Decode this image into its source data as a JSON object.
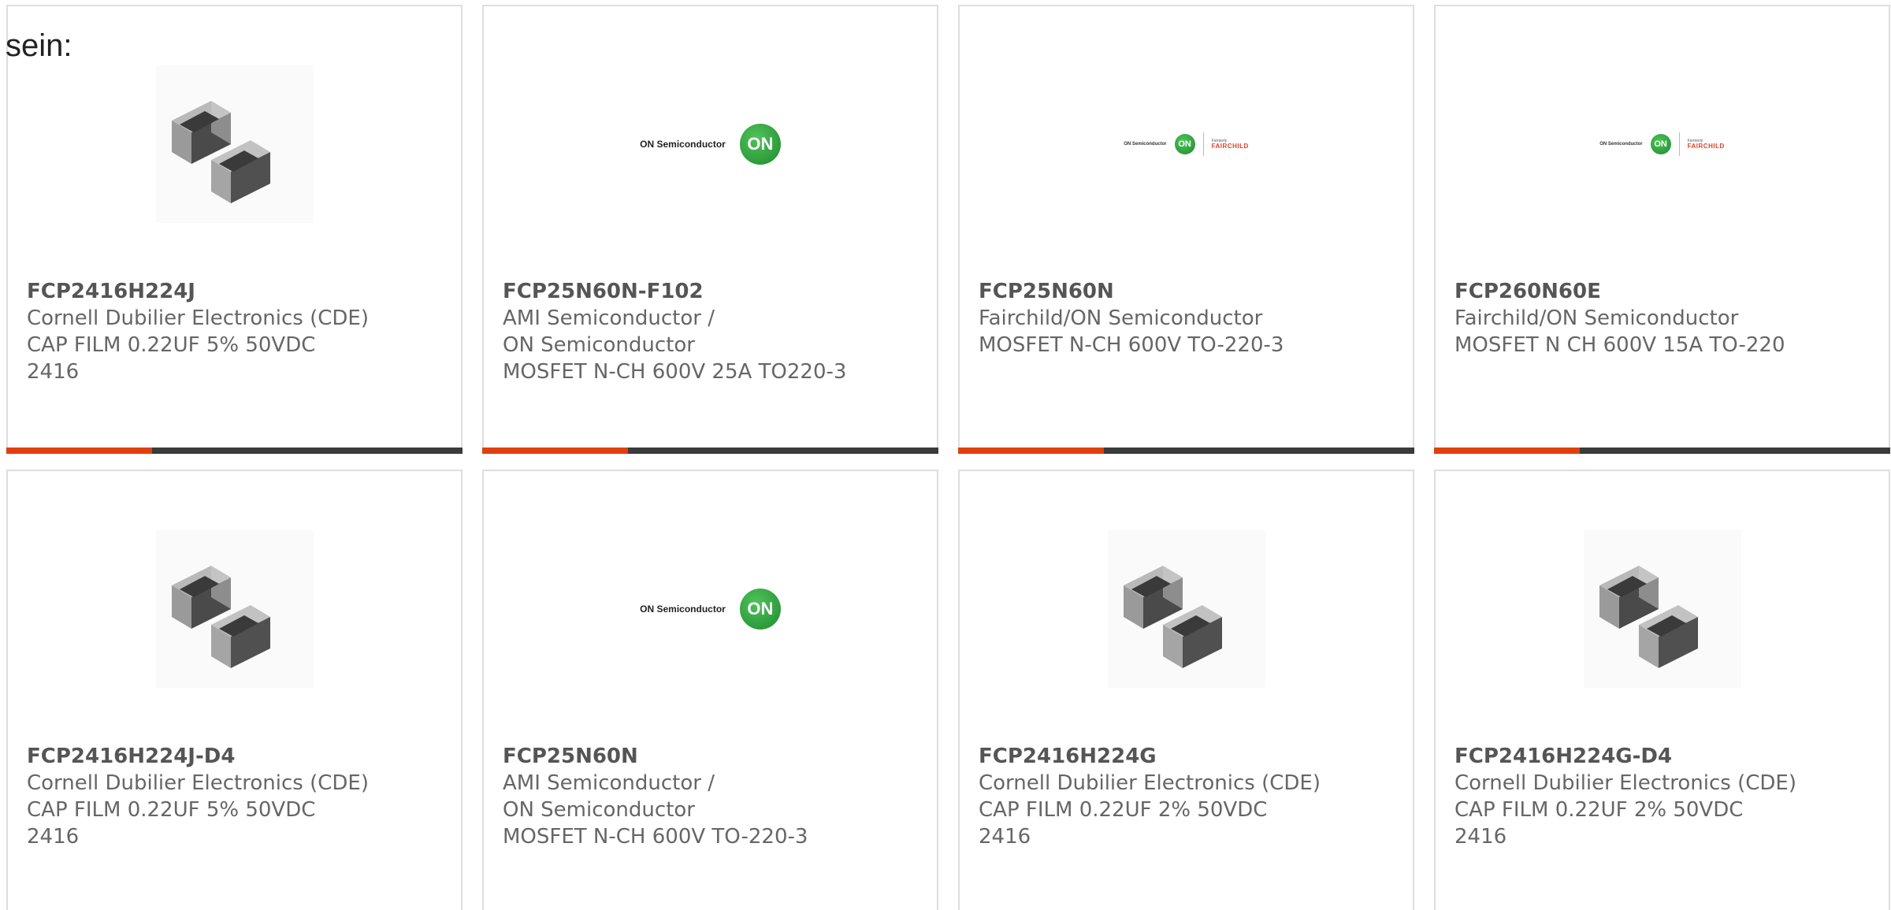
{
  "intro_text": "sein:",
  "colors": {
    "accent": "#e0400f",
    "bar_dark": "#3b3b3b",
    "border": "#dedede",
    "text": "#666666"
  },
  "products": [
    {
      "part_number": "FCP2416H224J",
      "manufacturer": "Cornell Dubilier Electronics (CDE)",
      "description_lines": [
        "CAP FILM 0.22UF 5% 50VDC",
        "2416"
      ],
      "image": "film-capacitor-chips"
    },
    {
      "part_number": "FCP25N60N-F102",
      "manufacturer": "AMI Semiconductor / ON Semiconductor",
      "manufacturer_lines": [
        "AMI Semiconductor / ON",
        "Semiconductor"
      ],
      "description_lines": [
        "MOSFET N-CH 600V 25A TO220-3"
      ],
      "image": "on-semiconductor-logo",
      "logo_text": "ON Semiconductor",
      "logo_badge": "ON"
    },
    {
      "part_number": "FCP25N60N",
      "manufacturer": "Fairchild/ON Semiconductor",
      "description_lines": [
        "MOSFET N-CH 600V TO-220-3"
      ],
      "image": "on-fairchild-logo",
      "logo_text": "ON Semiconductor",
      "logo_badge": "ON",
      "logo_formerly": "Formerly",
      "logo_brand": "FAIRCHILD"
    },
    {
      "part_number": "FCP260N60E",
      "manufacturer": "Fairchild/ON Semiconductor",
      "description_lines": [
        "MOSFET N CH 600V 15A TO-220"
      ],
      "image": "on-fairchild-logo",
      "logo_text": "ON Semiconductor",
      "logo_badge": "ON",
      "logo_formerly": "Formerly",
      "logo_brand": "FAIRCHILD"
    },
    {
      "part_number": "FCP2416H224J-D4",
      "manufacturer": "Cornell Dubilier Electronics (CDE)",
      "description_lines": [
        "CAP FILM 0.22UF 5% 50VDC",
        "2416"
      ],
      "image": "film-capacitor-chips"
    },
    {
      "part_number": "FCP25N60N",
      "manufacturer": "AMI Semiconductor / ON Semiconductor",
      "manufacturer_lines": [
        "AMI Semiconductor / ON",
        "Semiconductor"
      ],
      "description_lines": [
        "MOSFET N-CH 600V TO-220-3"
      ],
      "image": "on-semiconductor-logo",
      "logo_text": "ON Semiconductor",
      "logo_badge": "ON"
    },
    {
      "part_number": "FCP2416H224G",
      "manufacturer": "Cornell Dubilier Electronics (CDE)",
      "description_lines": [
        "CAP FILM 0.22UF 2% 50VDC",
        "2416"
      ],
      "image": "film-capacitor-chips"
    },
    {
      "part_number": "FCP2416H224G-D4",
      "manufacturer": "Cornell Dubilier Electronics (CDE)",
      "description_lines": [
        "CAP FILM 0.22UF 2% 50VDC",
        "2416"
      ],
      "image": "film-capacitor-chips"
    }
  ]
}
